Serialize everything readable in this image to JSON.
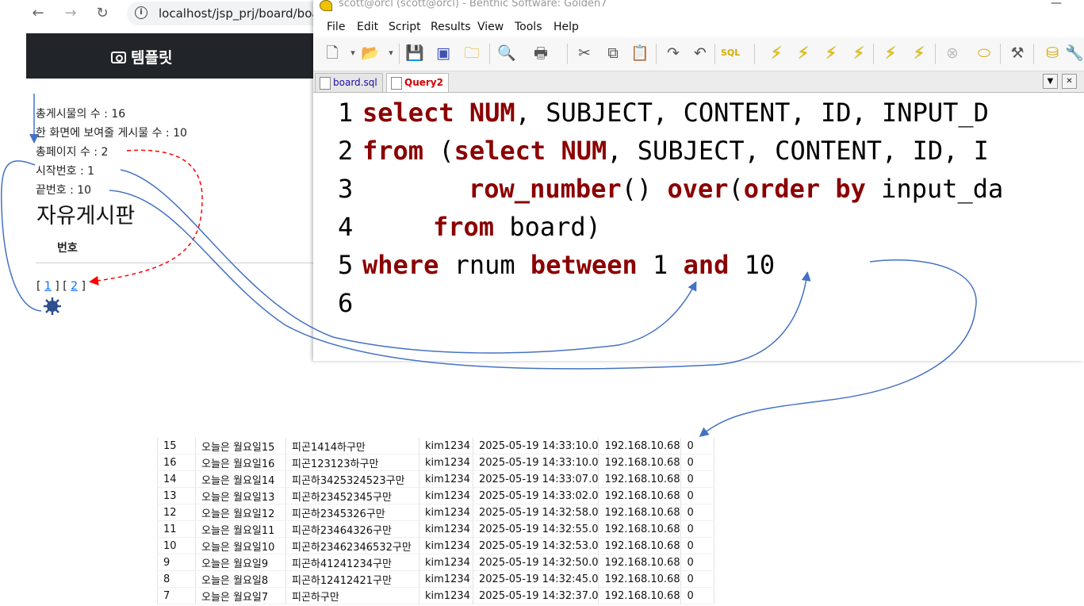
{
  "browser": {
    "nav": {
      "back": "←",
      "forward": "→",
      "reload": "↻"
    },
    "url": "localhost/jsp_prj/board/boa",
    "brand": "템플릿",
    "info_lines": [
      "총게시물의 수 : 16",
      "한 화면에 보여줄 게시물 수 : 10",
      "총페이지 수 : 2",
      "시작번호 : 1",
      "끝번호 : 10"
    ],
    "board_title": "자유게시판",
    "column_header": "번호",
    "pager": {
      "open1": "[ ",
      "page1": "1",
      "mid": " ] [ ",
      "page2": "2",
      "close": " ]"
    }
  },
  "golden": {
    "title": "scott@orcl (scott@orcl) - Benthic Software: Golden7",
    "min_button": "—",
    "menu": [
      "File",
      "Edit",
      "Script",
      "Results",
      "View",
      "Tools",
      "Help"
    ],
    "toolbar_icons": [
      "new-file-icon",
      "open-folder-icon",
      "save-icon",
      "save-all-icon",
      "open-recent-icon",
      "print-preview-icon",
      "print-icon",
      "cut-icon",
      "copy-icon",
      "paste-icon",
      "redo-icon",
      "undo-icon",
      "sql-format-icon",
      "execute-icon",
      "execute-statement-icon",
      "execute-one-icon",
      "execute-list-icon",
      "explain-icon",
      "explain-one-icon",
      "cancel-icon",
      "commit-icon",
      "tools-icon",
      "database-icon"
    ],
    "tabs": [
      "board.sql",
      "Query2"
    ],
    "tab_controls": {
      "dropdown": "▼",
      "close": "✕"
    },
    "line_numbers": [
      "1",
      "2",
      "3",
      "4",
      "5",
      "6"
    ],
    "code": {
      "l1_kw": "select",
      "l1_kw2": "NUM",
      "l1_rest": ", SUBJECT, CONTENT, ID, INPUT_D",
      "l2_kw": "from",
      "l2_paren": " (",
      "l2_kw2": "select NUM",
      "l2_rest": ", SUBJECT, CONTENT, ID, I",
      "l3_kw": "row_number",
      "l3_mid": "() ",
      "l3_kw2": "over",
      "l3_paren": "(",
      "l3_kw3": "order by",
      "l3_rest": " input_da",
      "l4_kw": "from",
      "l4_rest": " board)",
      "l5_kw": "where",
      "l5_mid": " rnum ",
      "l5_kw2": "between",
      "l5_num": " 1 ",
      "l5_kw3": "and",
      "l5_rest": " 10"
    }
  },
  "results": {
    "rows": [
      [
        "15",
        "오늘은 월요일15",
        "피곤1414하구만",
        "kim1234",
        "2025-05-19 14:33:10.0",
        "192.168.10.68",
        "0"
      ],
      [
        "16",
        "오늘은 월요일16",
        "피곤123123하구만",
        "kim1234",
        "2025-05-19 14:33:10.0",
        "192.168.10.68",
        "0"
      ],
      [
        "14",
        "오늘은 월요일14",
        "피곤하3425324523구만",
        "kim1234",
        "2025-05-19 14:33:07.0",
        "192.168.10.68",
        "0"
      ],
      [
        "13",
        "오늘은 월요일13",
        "피곤하23452345구만",
        "kim1234",
        "2025-05-19 14:33:02.0",
        "192.168.10.68",
        "0"
      ],
      [
        "12",
        "오늘은 월요일12",
        "피곤하2345326구만",
        "kim1234",
        "2025-05-19 14:32:58.0",
        "192.168.10.68",
        "0"
      ],
      [
        "11",
        "오늘은 월요일11",
        "피곤하23464326구만",
        "kim1234",
        "2025-05-19 14:32:55.0",
        "192.168.10.68",
        "0"
      ],
      [
        "10",
        "오늘은 월요일10",
        "피곤하23462346532구만",
        "kim1234",
        "2025-05-19 14:32:53.0",
        "192.168.10.68",
        "0"
      ],
      [
        "9",
        "오늘은 월요일9",
        "피곤하41241234구만",
        "kim1234",
        "2025-05-19 14:32:50.0",
        "192.168.10.68",
        "0"
      ],
      [
        "8",
        "오늘은 월요일8",
        "피곤하12412421구만",
        "kim1234",
        "2025-05-19 14:32:45.0",
        "192.168.10.68",
        "0"
      ],
      [
        "7",
        "오늘은 월요일7",
        "피곤하구만",
        "kim1234",
        "2025-05-19 14:32:37.0",
        "192.168.10.68",
        "0"
      ]
    ]
  },
  "colors": {
    "keyword": "#8b0000",
    "annotation_blue": "#4472c4",
    "annotation_red": "#ff0000",
    "header_dark": "#212529",
    "link": "#0d6efd"
  }
}
